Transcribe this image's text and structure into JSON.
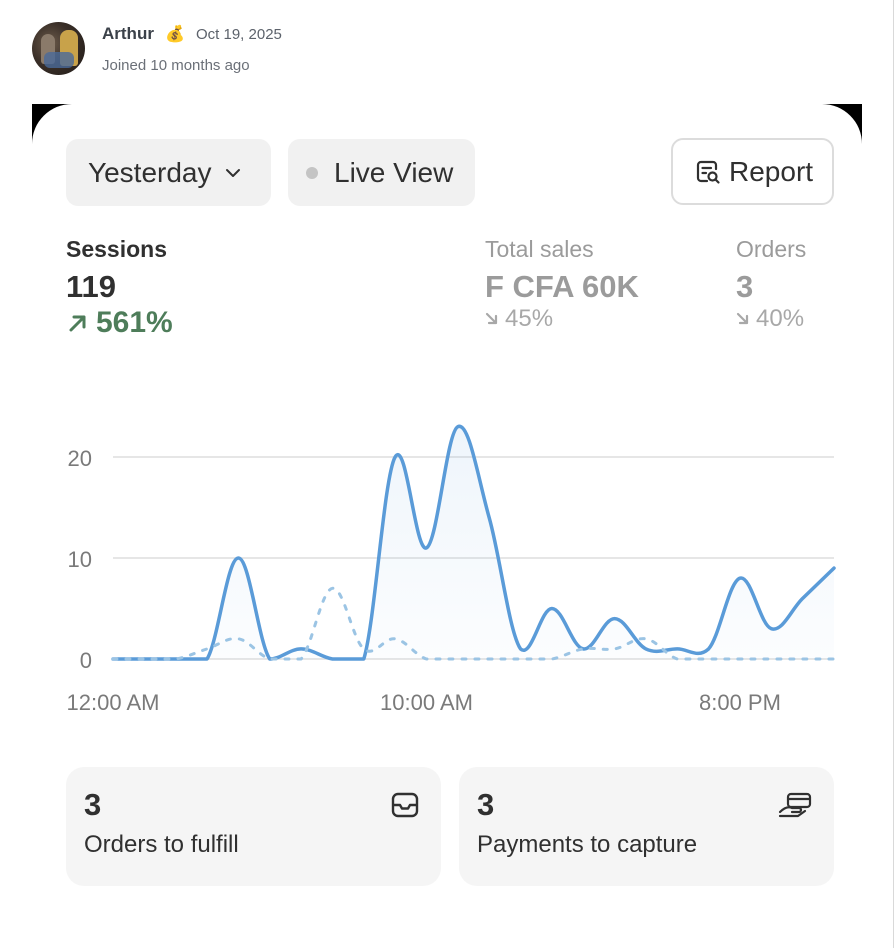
{
  "post": {
    "author": "Arthur",
    "badge_icon": "money-bag-icon",
    "date": "Oct 19, 2025",
    "joined": "Joined 10 months ago"
  },
  "toolbar": {
    "date_range": "Yesterday",
    "live_view": "Live View",
    "report": "Report"
  },
  "metrics": {
    "sessions": {
      "label": "Sessions",
      "value": "119",
      "change": "561%",
      "direction": "up"
    },
    "total_sales": {
      "label": "Total sales",
      "value": "F CFA 60K",
      "change": "45%",
      "direction": "down"
    },
    "orders": {
      "label": "Orders",
      "value": "3",
      "change": "40%",
      "direction": "down"
    }
  },
  "chart_data": {
    "type": "line",
    "x_tick_labels": [
      "12:00 AM",
      "10:00 AM",
      "8:00 PM"
    ],
    "y_ticks": [
      0,
      10,
      20
    ],
    "ylim": [
      0,
      23
    ],
    "hours": 24,
    "series": [
      {
        "style": "solid",
        "color": "#5a9bd8",
        "values": [
          0,
          0,
          0,
          0,
          10,
          0,
          1,
          0,
          0,
          20,
          11,
          23,
          14,
          1,
          5,
          1,
          4,
          1,
          1,
          1,
          8,
          3,
          6,
          9
        ]
      },
      {
        "style": "dashed",
        "color": "#9bc4e4",
        "values": [
          0,
          0,
          0,
          1,
          2,
          0,
          0,
          7,
          1,
          2,
          0,
          0,
          0,
          0,
          0,
          1,
          1,
          2,
          0,
          0,
          0,
          0,
          0,
          0
        ]
      }
    ]
  },
  "tiles": [
    {
      "count": "3",
      "label": "Orders to fulfill",
      "icon": "inbox-icon"
    },
    {
      "count": "3",
      "label": "Payments to capture",
      "icon": "hand-card-icon"
    }
  ],
  "colors": {
    "accent_line": "#5a9bd8",
    "positive": "#4e7d5a",
    "muted": "#9b9b9b"
  }
}
